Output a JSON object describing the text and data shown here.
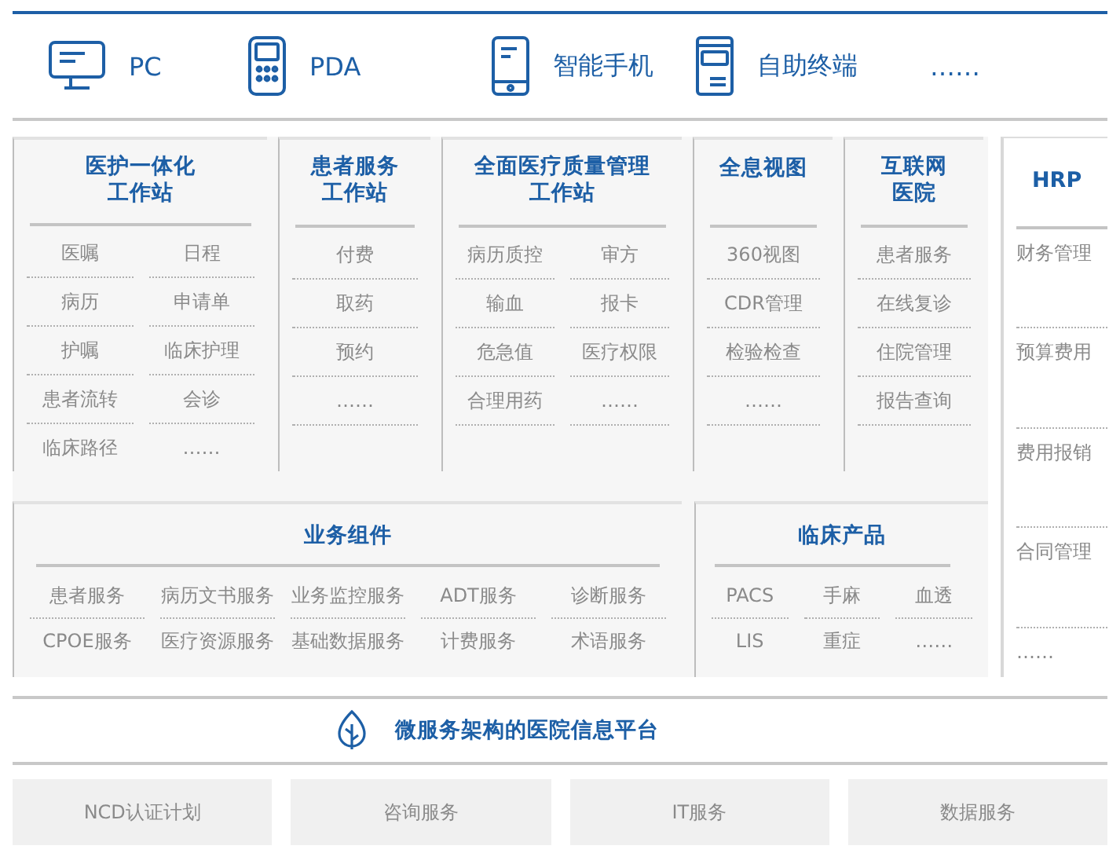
{
  "devices": [
    {
      "kind": "pc",
      "label": "PC"
    },
    {
      "kind": "pda",
      "label": "PDA"
    },
    {
      "kind": "phone",
      "label": "智能手机"
    },
    {
      "kind": "kiosk",
      "label": "自助终端"
    },
    {
      "kind": "more",
      "label": "……"
    }
  ],
  "workstations": [
    {
      "title": "医护一体化工作站",
      "rows": [
        [
          "医嘱",
          "日程"
        ],
        [
          "病历",
          "申请单"
        ],
        [
          "护嘱",
          "临床护理"
        ],
        [
          "患者流转",
          "会诊"
        ],
        [
          "临床路径",
          "……"
        ]
      ]
    },
    {
      "title": "患者服务工作站",
      "rows": [
        [
          "付费"
        ],
        [
          "取药"
        ],
        [
          "预约"
        ],
        [
          "……"
        ]
      ]
    },
    {
      "title": "全面医疗质量管理工作站",
      "rows": [
        [
          "病历质控",
          "审方"
        ],
        [
          "输血",
          "报卡"
        ],
        [
          "危急值",
          "医疗权限"
        ],
        [
          "合理用药",
          "……"
        ]
      ]
    },
    {
      "title": "全息视图",
      "rows": [
        [
          "360视图"
        ],
        [
          "CDR管理"
        ],
        [
          "检验检查"
        ],
        [
          "……"
        ]
      ]
    },
    {
      "title": "互联网医院",
      "rows": [
        [
          "患者服务"
        ],
        [
          "在线复诊"
        ],
        [
          "住院管理"
        ],
        [
          "报告查询"
        ]
      ]
    }
  ],
  "hrp": {
    "title": "HRP",
    "items": [
      "财务管理",
      "预算费用",
      "费用报销",
      "合同管理",
      "……"
    ]
  },
  "components": {
    "title": "业务组件",
    "rows": [
      [
        "患者服务",
        "病历文书服务",
        "业务监控服务",
        "ADT服务",
        "诊断服务"
      ],
      [
        "CPOE服务",
        "医疗资源服务",
        "基础数据服务",
        "计费服务",
        "术语服务"
      ]
    ]
  },
  "clinical_products": {
    "title": "临床产品",
    "rows": [
      [
        "PACS",
        "手麻",
        "血透"
      ],
      [
        "LIS",
        "重症",
        "……"
      ]
    ]
  },
  "platform": {
    "title": "微服务架构的医院信息平台"
  },
  "services": [
    "NCD认证计划",
    "咨询服务",
    "IT服务",
    "数据服务"
  ]
}
